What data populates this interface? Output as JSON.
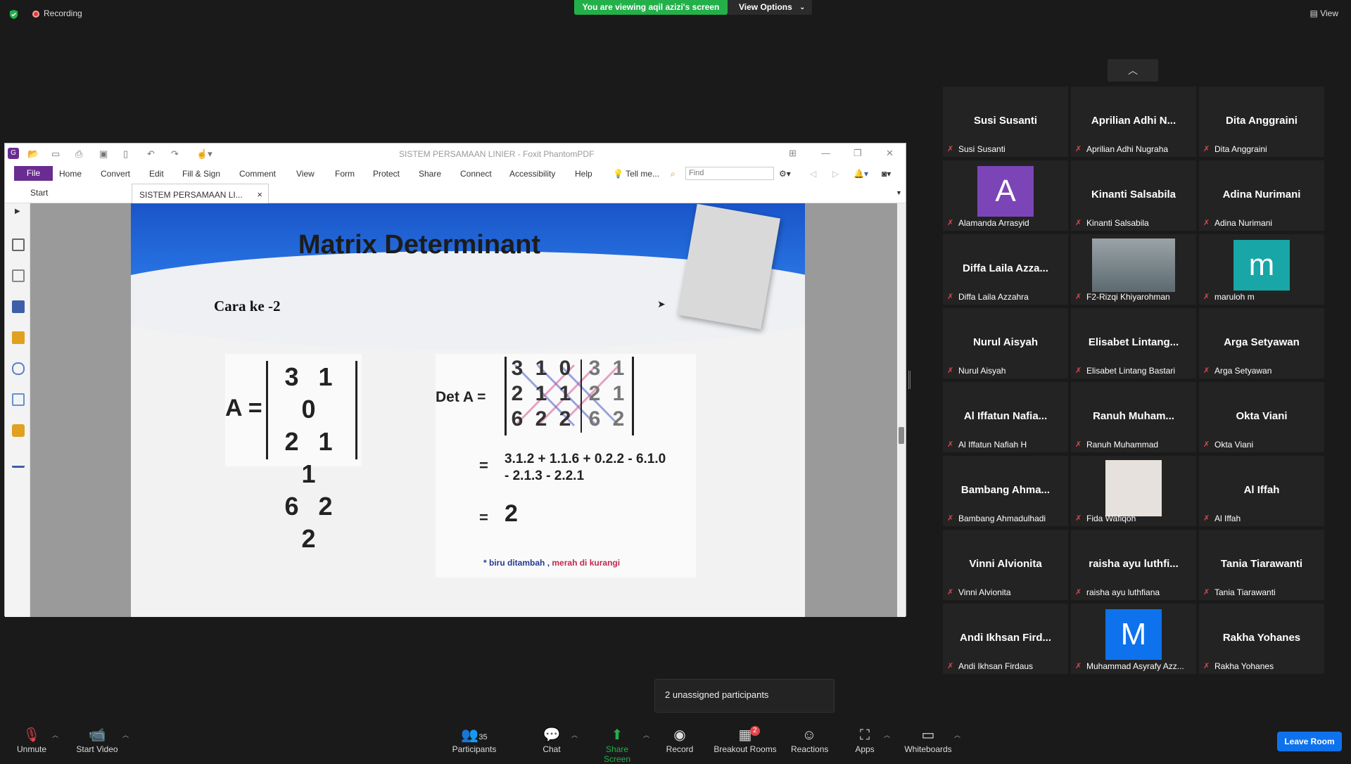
{
  "top": {
    "recording_label": "Recording",
    "viewing_banner": "You are viewing aqil azizi's screen",
    "view_options": "View Options",
    "view_label": "View"
  },
  "app": {
    "title": "SISTEM PERSAMAAN LINIER - Foxit PhantomPDF",
    "menu": {
      "file": "File",
      "home": "Home",
      "convert": "Convert",
      "edit": "Edit",
      "fill_sign": "Fill & Sign",
      "comment": "Comment",
      "view": "View",
      "form": "Form",
      "protect": "Protect",
      "share": "Share",
      "connect": "Connect",
      "accessibility": "Accessibility",
      "help": "Help",
      "tell_me": "Tell me..."
    },
    "find_placeholder": "Find",
    "tabs": {
      "start": "Start",
      "document": "SISTEM PERSAMAAN LI...",
      "close": "×"
    }
  },
  "slide": {
    "title": "Matrix Determinant",
    "subheading": "Cara ke -2",
    "matrix_a_label": "A =",
    "matrix_a_rows": [
      "3 1 0",
      "2 1 1",
      "6 2 2"
    ],
    "det_label": "Det A =",
    "det_rows": [
      [
        "3",
        "1",
        "0",
        "3",
        "1"
      ],
      [
        "2",
        "1",
        "1",
        "2",
        "1"
      ],
      [
        "6",
        "2",
        "2",
        "6",
        "2"
      ]
    ],
    "eq_sign": "=",
    "expression_line1": "3.1.2 + 1.1.6 + 0.2.2 - 6.1.0",
    "expression_line2": "- 2.1.3 - 2.2.1",
    "result": "2",
    "note_star": "*",
    "note_blue": "biru ditambah",
    "note_sep": " ,",
    "note_red": "merah di kurangi"
  },
  "participants": [
    {
      "name": "Susi Susanti",
      "label": "Susi Susanti",
      "type": "text"
    },
    {
      "name": "Aprilian Adhi N...",
      "label": "Aprilian Adhi Nugraha",
      "type": "text"
    },
    {
      "name": "Dita Anggraini",
      "label": "Dita Anggraini",
      "type": "text"
    },
    {
      "name": "A",
      "label": "Alamanda Arrasyid",
      "type": "avatar",
      "color": "#7b45b8"
    },
    {
      "name": "Kinanti Salsabila",
      "label": "Kinanti Salsabila",
      "type": "text"
    },
    {
      "name": "Adina Nurimani",
      "label": "Adina Nurimani",
      "type": "text"
    },
    {
      "name": "Diffa Laila Azza...",
      "label": "Diffa Laila Azzahra",
      "type": "text"
    },
    {
      "name": "",
      "label": "F2-Rizqi Khiyarohman",
      "type": "photo"
    },
    {
      "name": "m",
      "label": "maruloh m",
      "type": "avatar",
      "color": "#18a6a6"
    },
    {
      "name": "Nurul Aisyah",
      "label": "Nurul Aisyah",
      "type": "text"
    },
    {
      "name": "Elisabet Lintang...",
      "label": "Elisabet Lintang Bastari",
      "type": "text"
    },
    {
      "name": "Arga Setyawan",
      "label": "Arga Setyawan",
      "type": "text"
    },
    {
      "name": "Al Iffatun Nafia...",
      "label": "Al Iffatun Nafiah H",
      "type": "text"
    },
    {
      "name": "Ranuh Muham...",
      "label": "Ranuh Muhammad",
      "type": "text"
    },
    {
      "name": "Okta Viani",
      "label": "Okta Viani",
      "type": "text"
    },
    {
      "name": "Bambang Ahma...",
      "label": "Bambang Ahmadulhadi",
      "type": "text"
    },
    {
      "name": "",
      "label": "Fida Wafiqoh",
      "type": "photo2"
    },
    {
      "name": "Al Iffah",
      "label": "Al Iffah",
      "type": "text"
    },
    {
      "name": "Vinni Alvionita",
      "label": "Vinni Alvionita",
      "type": "text"
    },
    {
      "name": "raisha ayu luthfi...",
      "label": "raisha ayu luthfiana",
      "type": "text"
    },
    {
      "name": "Tania Tiarawanti",
      "label": "Tania Tiarawanti",
      "type": "text"
    },
    {
      "name": "Andi Ikhsan Fird...",
      "label": "Andi Ikhsan Firdaus",
      "type": "text"
    },
    {
      "name": "M",
      "label": "Muhammad Asyrafy Azz...",
      "type": "avatar",
      "color": "#0e72ed"
    },
    {
      "name": "Rakha Yohanes",
      "label": "Rakha Yohanes",
      "type": "text"
    }
  ],
  "unassigned": "2 unassigned participants",
  "toolbar": {
    "unmute": "Unmute",
    "start_video": "Start Video",
    "participants": "Participants",
    "participants_count": "35",
    "chat": "Chat",
    "share_screen": "Share Screen",
    "record": "Record",
    "breakout_rooms": "Breakout Rooms",
    "breakout_badge": "2",
    "reactions": "Reactions",
    "apps": "Apps",
    "whiteboards": "Whiteboards",
    "leave_room": "Leave Room"
  },
  "colors": {
    "accent_green": "#23b04a",
    "foxit_purple": "#6a2c91",
    "zoom_blue": "#0e72ed",
    "muted_red": "#e0454a"
  }
}
